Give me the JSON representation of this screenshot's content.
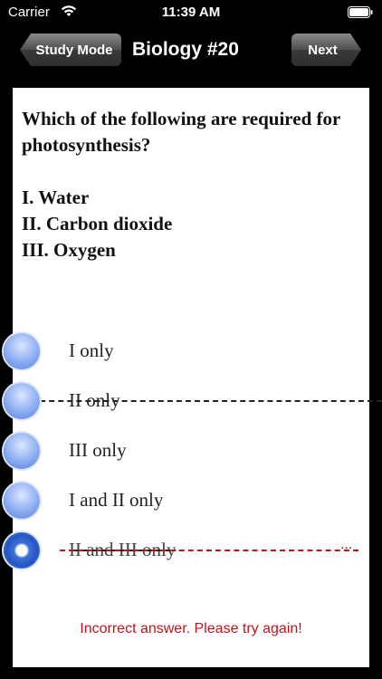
{
  "status_bar": {
    "carrier": "Carrier",
    "time": "11:39 AM"
  },
  "nav": {
    "back_label": "Study Mode",
    "title": "Biology #20",
    "next_label": "Next"
  },
  "question": {
    "prompt": "Which of the following are required for photosynthesis?",
    "items": [
      "I. Water",
      "II. Carbon dioxide",
      "III. Oxygen"
    ]
  },
  "options": [
    {
      "label": "I only",
      "selected": false
    },
    {
      "label": "II only",
      "selected": false
    },
    {
      "label": "III only",
      "selected": false
    },
    {
      "label": "I and II only",
      "selected": false
    },
    {
      "label": "II and III only",
      "selected": true,
      "marked_wrong": true
    }
  ],
  "feedback": "Incorrect answer. Please try again!",
  "colors": {
    "error": "#c0141a",
    "radio": "#7aa0ef"
  }
}
